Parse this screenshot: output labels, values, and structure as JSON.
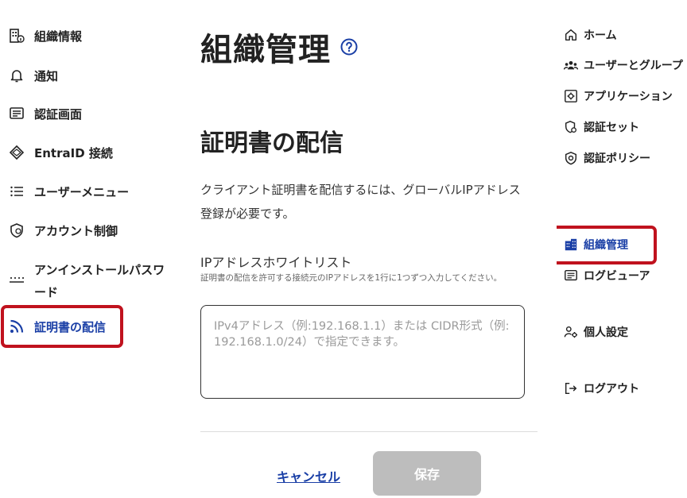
{
  "left_nav": {
    "items": [
      {
        "label": "組織情報",
        "icon": "building-info-icon"
      },
      {
        "label": "通知",
        "icon": "bell-icon"
      },
      {
        "label": "認証画面",
        "icon": "screen-list-icon"
      },
      {
        "label": "EntraID 接続",
        "icon": "entra-diamond-icon"
      },
      {
        "label": "ユーザーメニュー",
        "icon": "menu-list-icon"
      },
      {
        "label": "アカウント制御",
        "icon": "shield-user-icon"
      },
      {
        "label": "アンインストールパスワード",
        "icon": "password-dots-icon"
      },
      {
        "label": "証明書の配信",
        "icon": "rss-feed-icon"
      }
    ],
    "active_index": 7
  },
  "main": {
    "page_title": "組織管理",
    "section_title": "証明書の配信",
    "description": "クライアント証明書を配信するには、グローバルIPアドレス登録が必要です。",
    "field_label": "IPアドレスホワイトリスト",
    "field_hint": "証明書の配信を許可する接続元のIPアドレスを1行に1つずつ入力してください。",
    "field_placeholder": "IPv4アドレス（例:192.168.1.1）または CIDR形式（例: 192.168.1.0/24）で指定できます。",
    "field_value": "",
    "cancel_label": "キャンセル",
    "save_label": "保存"
  },
  "right_nav": {
    "items": [
      {
        "label": "ホーム",
        "icon": "home-icon"
      },
      {
        "label": "ユーザーとグループ",
        "icon": "users-group-icon"
      },
      {
        "label": "アプリケーション",
        "icon": "app-gear-icon"
      },
      {
        "label": "認証セット",
        "icon": "shield-gear-icon"
      },
      {
        "label": "認証ポリシー",
        "icon": "shield-policy-icon"
      },
      {
        "label": "組織管理",
        "icon": "organization-icon"
      },
      {
        "label": "ログビューア",
        "icon": "log-viewer-icon"
      },
      {
        "label": "個人設定",
        "icon": "person-gear-icon"
      },
      {
        "label": "ログアウト",
        "icon": "logout-icon"
      }
    ],
    "active_index": 5
  },
  "colors": {
    "accent": "#1a3fa6",
    "highlight": "#c0121e",
    "disabled_button": "#bdbdbd"
  }
}
